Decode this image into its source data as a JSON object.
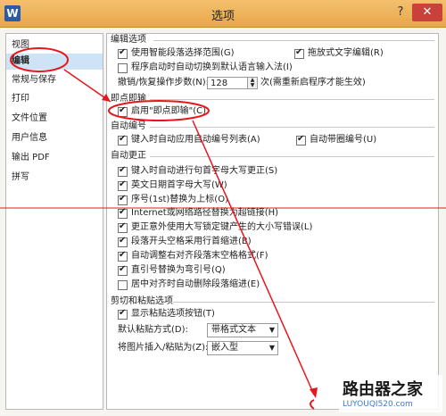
{
  "window": {
    "title": "选项",
    "app_icon": "W",
    "help": "?",
    "close": "✕"
  },
  "sidebar": {
    "items": [
      {
        "label": "视图"
      },
      {
        "label": "编辑"
      },
      {
        "label": "常规与保存"
      },
      {
        "label": "打印"
      },
      {
        "label": "文件位置"
      },
      {
        "label": "用户信息"
      },
      {
        "label": "输出 PDF"
      },
      {
        "label": "拼写"
      }
    ],
    "selected": "编辑"
  },
  "edit_options": {
    "header": "编辑选项",
    "smart_select": "使用智能段落选择范围(G)",
    "drag_edit": "拖放式文字编辑(R)",
    "auto_ime": "程序启动时自动切换到默认语言输入法(I)",
    "undo_label": "撤销/恢复操作步数(N):",
    "undo_value": "128",
    "undo_note": "次(需重新启程序才能生效)"
  },
  "click_type": {
    "header": "即点即输",
    "enable": "启用\"即点即输\"(C)"
  },
  "auto_number": {
    "header": "自动编号",
    "apply_list": "键入时自动应用自动编号列表(A)",
    "bullet": "自动带圈编号(U)"
  },
  "autocorrect": {
    "header": "自动更正",
    "items": [
      {
        "label": "键入时自动进行句首字母大写更正(S)"
      },
      {
        "label": "英文日期首字母大写(W)"
      },
      {
        "label": "序号(1st)替换为上标(O)"
      },
      {
        "label": "Internet或网络路径替换为超链接(H)"
      },
      {
        "label": "更正意外使用大写锁定键产生的大小写错误(L)"
      },
      {
        "label": "段落开头空格采用行首缩进(B)"
      },
      {
        "label": "自动调整右对齐段落末空格格式(F)"
      },
      {
        "label": "直引号替换为弯引号(Q)"
      },
      {
        "label": "居中对齐时自动删除段落缩进(E)"
      }
    ]
  },
  "cut_paste": {
    "header": "剪切和粘贴选项",
    "show_button": "显示粘贴选项按钮(T)",
    "default_paste_label": "默认粘贴方式(D):",
    "default_paste_value": "带格式文本",
    "image_paste_label": "将图片插入/粘贴为(Z):",
    "image_paste_value": "嵌入型"
  },
  "watermark": {
    "title": "路由器之家",
    "url": "LUYOUQI520.com"
  },
  "colors": {
    "annotation": "#e8161b",
    "selected": "#cfe3f7",
    "title_bar": "#eab15a"
  }
}
